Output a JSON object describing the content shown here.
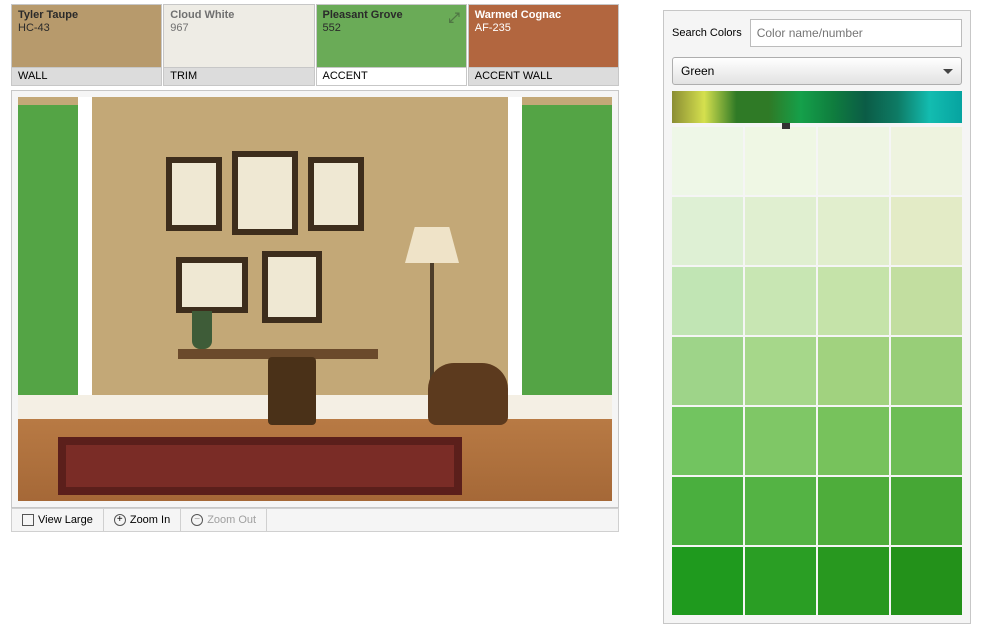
{
  "swatches": [
    {
      "name": "Tyler Taupe",
      "code": "HC-43",
      "role": "WALL",
      "color": "#b79a6c",
      "text_color": "#2a2a2a",
      "selected": false
    },
    {
      "name": "Cloud White",
      "code": "967",
      "role": "TRIM",
      "color": "#eeece5",
      "text_color": "#707070",
      "selected": false
    },
    {
      "name": "Pleasant Grove",
      "code": "552",
      "role": "ACCENT",
      "color": "#6aab57",
      "text_color": "#2a2a2a",
      "selected": true
    },
    {
      "name": "Warmed Cognac",
      "code": "AF-235",
      "role": "ACCENT WALL",
      "color": "#b2663f",
      "text_color": "#ffffff",
      "selected": false
    }
  ],
  "controls": {
    "view_large": "View Large",
    "zoom_in": "Zoom In",
    "zoom_out": "Zoom Out"
  },
  "search": {
    "label": "Search Colors",
    "placeholder": "Color name/number"
  },
  "filter": {
    "selected": "Green"
  },
  "palette": [
    "#eef7e7",
    "#eff7e4",
    "#eef5e3",
    "#eef3df",
    "#def0d4",
    "#e0efd0",
    "#e1eecd",
    "#e3ebc6",
    "#c1e5b4",
    "#c8e6b3",
    "#c5e3a9",
    "#c2dea0",
    "#9ed489",
    "#a6d78a",
    "#a1d27f",
    "#98ce78",
    "#72c460",
    "#7fc766",
    "#77c25c",
    "#6dbd55",
    "#4aaf3e",
    "#54b344",
    "#4ead3b",
    "#46a735",
    "#1f9a1e",
    "#2a9e24",
    "#28981f",
    "#23911a"
  ]
}
